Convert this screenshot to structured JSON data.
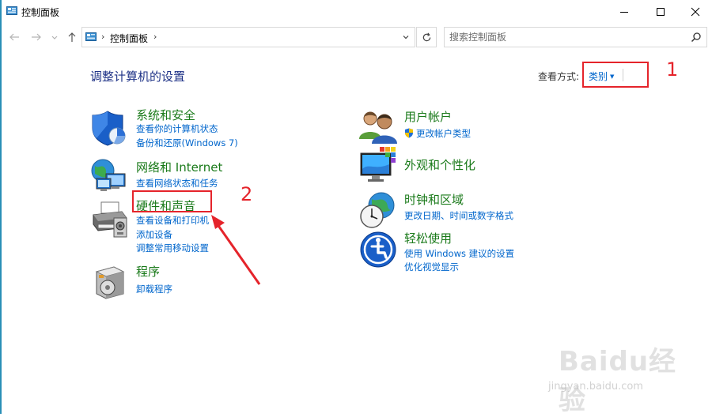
{
  "window": {
    "title": "控制面板"
  },
  "nav": {
    "address_path": "控制面板",
    "search_placeholder": "搜索控制面板"
  },
  "main": {
    "page_title": "调整计算机的设置",
    "viewby_label": "查看方式:",
    "viewby_value": "类别"
  },
  "categories_left": [
    {
      "title": "系统和安全",
      "links": [
        "查看你的计算机状态",
        "备份和还原(Windows 7)"
      ],
      "icon": "system-security-icon"
    },
    {
      "title": "网络和 Internet",
      "links": [
        "查看网络状态和任务"
      ],
      "icon": "network-icon"
    },
    {
      "title": "硬件和声音",
      "links": [
        "查看设备和打印机",
        "添加设备",
        "调整常用移动设置"
      ],
      "icon": "printer-icon"
    },
    {
      "title": "程序",
      "links": [
        "卸载程序"
      ],
      "icon": "programs-icon"
    }
  ],
  "categories_right": [
    {
      "title": "用户帐户",
      "links": [
        "更改帐户类型"
      ],
      "icon": "user-accounts-icon"
    },
    {
      "title": "外观和个性化",
      "links": [],
      "icon": "appearance-icon"
    },
    {
      "title": "时钟和区域",
      "links": [
        "更改日期、时间或数字格式"
      ],
      "icon": "clock-region-icon"
    },
    {
      "title": "轻松使用",
      "links": [
        "使用 Windows 建议的设置",
        "优化视觉显示"
      ],
      "icon": "ease-of-access-icon"
    }
  ],
  "annotations": {
    "label_1": "1",
    "label_2": "2",
    "color": "#e5242b"
  },
  "watermark": {
    "brand": "Baidu经验",
    "url": "jingyan.baidu.com"
  },
  "colors": {
    "title_blue": "#1e3287",
    "category_green": "#1a7a1a",
    "link_blue": "#0066cc"
  }
}
